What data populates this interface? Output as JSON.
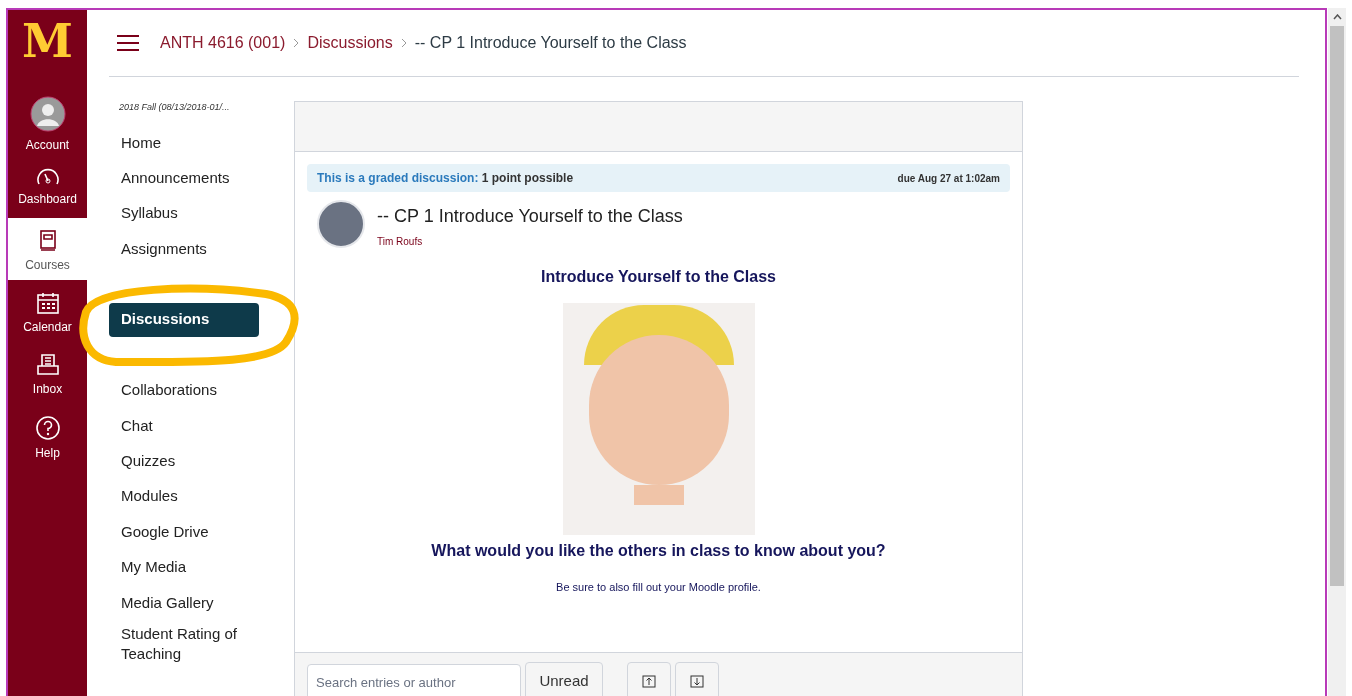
{
  "global_nav": [
    {
      "kind": "logo",
      "label": "M"
    },
    {
      "kind": "avatar",
      "label": "Account",
      "selected": false
    },
    {
      "kind": "dashboard",
      "label": "Dashboard",
      "selected": false
    },
    {
      "kind": "courses",
      "label": "Courses",
      "selected": true
    },
    {
      "kind": "calendar",
      "label": "Calendar",
      "selected": false
    },
    {
      "kind": "inbox",
      "label": "Inbox",
      "selected": false
    },
    {
      "kind": "help",
      "label": "Help",
      "selected": false
    }
  ],
  "breadcrumb": [
    "ANTH 4616 (001)",
    "Discussions",
    "-- CP 1 Introduce Yourself to the Class"
  ],
  "course_nav": {
    "term": "2018 Fall (08/13/2018-01/...",
    "items": [
      {
        "label": "Home",
        "selected": false
      },
      {
        "label": "Announcements",
        "selected": false
      },
      {
        "label": "Syllabus",
        "selected": false
      },
      {
        "label": "Assignments",
        "selected": false
      },
      {
        "label": "Discussions",
        "selected": true
      },
      {
        "label": "Collaborations",
        "selected": false
      },
      {
        "label": "Chat",
        "selected": false
      },
      {
        "label": "Quizzes",
        "selected": false
      },
      {
        "label": "Modules",
        "selected": false
      },
      {
        "label": "Google Drive",
        "selected": false
      },
      {
        "label": "My Media",
        "selected": false
      },
      {
        "label": "Media Gallery",
        "selected": false
      },
      {
        "label": "Student Rating of Teaching",
        "selected": false
      }
    ]
  },
  "discussion": {
    "graded_label": "This is a graded discussion:",
    "points": "1 point possible",
    "due": "due Aug 27 at 1:02am",
    "title": "-- CP 1 Introduce Yourself to the Class",
    "author": "Tim Roufs",
    "heading": "Introduce Yourself to the Class",
    "question": "What would you like the others in class to know about you?",
    "note": "Be sure to also fill out your Moodle profile."
  },
  "toolbar": {
    "search": {
      "placeholder": "Search entries or author"
    },
    "unread_button": "Unread"
  }
}
